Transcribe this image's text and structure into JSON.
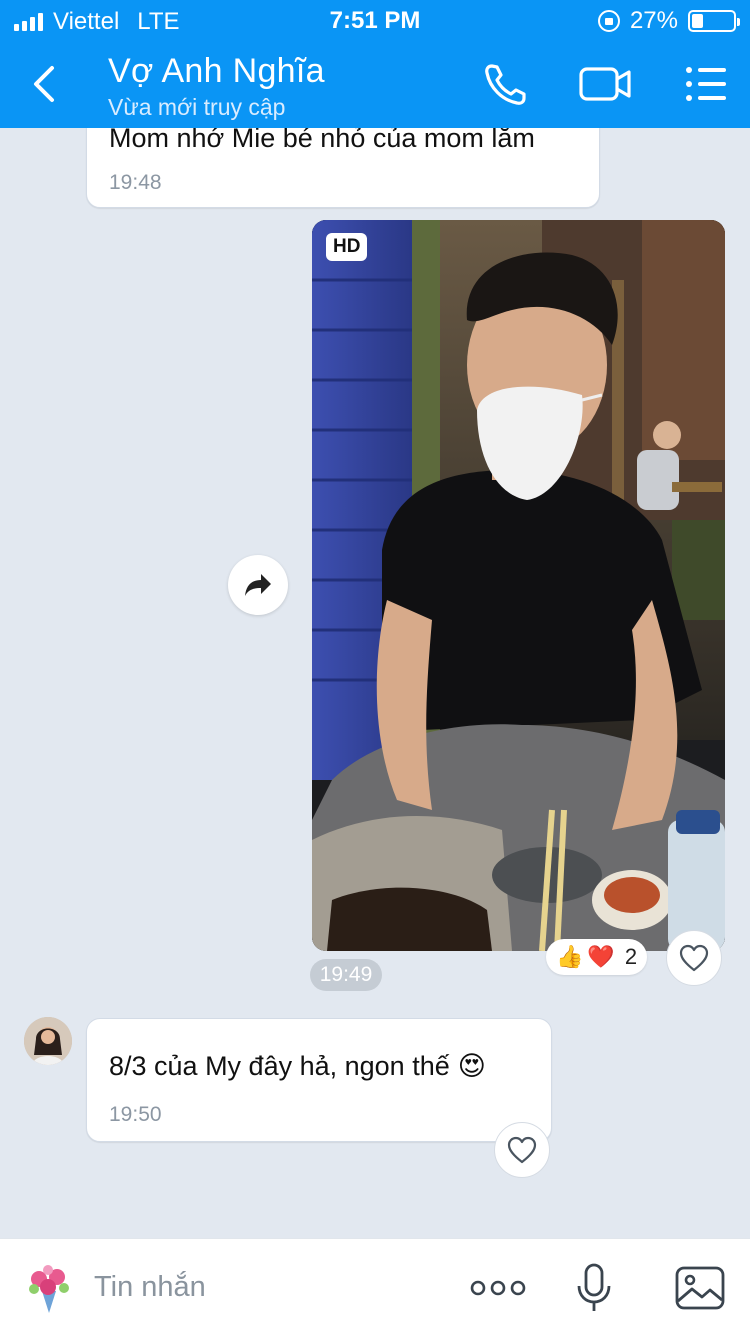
{
  "status_bar": {
    "carrier": "Viettel",
    "network": "LTE",
    "time": "7:51 PM",
    "battery": "27%",
    "battery_level": 0.27
  },
  "header": {
    "title": "Vợ Anh Nghĩa",
    "subtitle": "Vừa mới truy cập",
    "icons": [
      "back-icon",
      "phone-icon",
      "video-call-icon",
      "menu-icon"
    ]
  },
  "messages": [
    {
      "text": "Mom nhớ Mie bé nhỏ của mom lắm",
      "time": "19:48"
    },
    {
      "type": "photo",
      "badge": "HD",
      "time": "19:49",
      "reactions": {
        "count": "2",
        "icons": [
          "thumbs-up",
          "heart"
        ]
      }
    },
    {
      "text": "8/3 của My đây hả, ngon thế",
      "emoji": "😍",
      "time": "19:50"
    }
  ],
  "input": {
    "placeholder": "Tin nhắn"
  },
  "colors": {
    "header_bg": "#0a95f5",
    "chat_bg": "#e2e8f0",
    "bubble_bg": "#ffffff"
  }
}
